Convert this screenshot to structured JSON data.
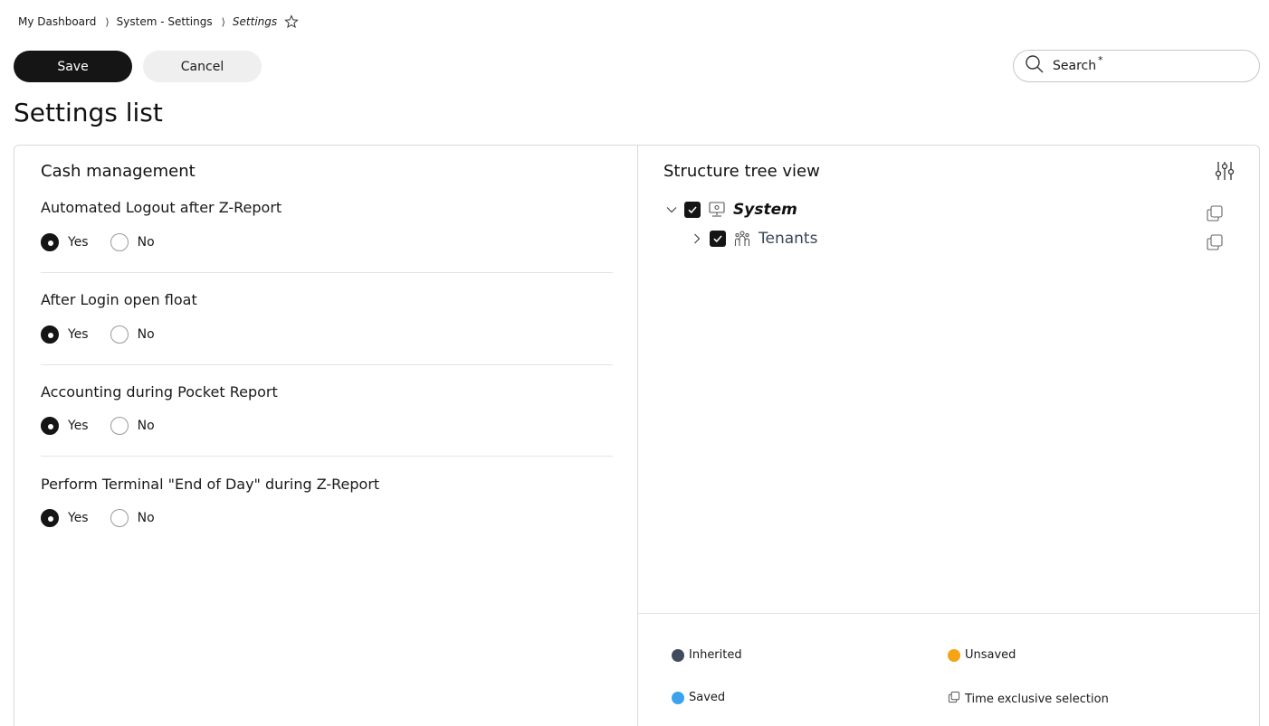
{
  "breadcrumb": {
    "items": [
      "My Dashboard",
      "System - Settings"
    ],
    "current": "Settings",
    "separator": "⟩"
  },
  "toolbar": {
    "save_label": "Save",
    "cancel_label": "Cancel"
  },
  "search": {
    "placeholder": "Search",
    "required_mark": "*"
  },
  "page": {
    "title": "Settings list"
  },
  "settings_panel": {
    "section_title": "Cash management",
    "yes_label": "Yes",
    "no_label": "No",
    "items": [
      {
        "label": "Automated Logout after Z-Report",
        "value": "Yes"
      },
      {
        "label": "After Login open float",
        "value": "Yes"
      },
      {
        "label": "Accounting during Pocket Report",
        "value": "Yes"
      },
      {
        "label": "Perform Terminal \"End of Day\" during Z-Report",
        "value": "Yes"
      }
    ]
  },
  "tree": {
    "title": "Structure tree view",
    "nodes": [
      {
        "label": "System",
        "expanded": true,
        "checked": true,
        "icon": "monitor-icon"
      },
      {
        "label": "Tenants",
        "expanded": false,
        "checked": true,
        "icon": "people-icon"
      }
    ]
  },
  "legend": {
    "inherited": {
      "label": "Inherited",
      "color": "#424b5e"
    },
    "unsaved": {
      "label": "Unsaved",
      "color": "#f5a415"
    },
    "saved": {
      "label": "Saved",
      "color": "#3ba3ee"
    },
    "time_exclusive": {
      "label": "Time exclusive selection",
      "icon": "copy-icon"
    }
  }
}
